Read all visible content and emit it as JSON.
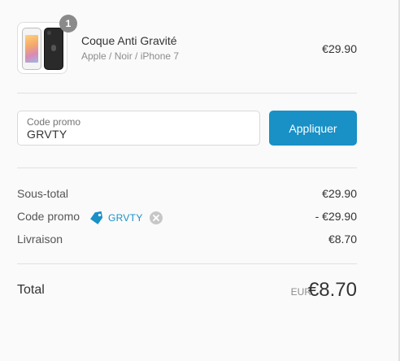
{
  "product": {
    "quantity": "1",
    "name": "Coque Anti Gravité",
    "variant": "Apple / Noir / iPhone 7",
    "price": "€29.90",
    "image_icon": "phone-case-thumbnail"
  },
  "promo": {
    "label": "Code promo",
    "value": "GRVTY",
    "apply_label": "Appliquer"
  },
  "totals": {
    "subtotal_label": "Sous-total",
    "subtotal_value": "€29.90",
    "discount_label": "Code promo",
    "discount_code": "GRVTY",
    "discount_value": "- €29.90",
    "shipping_label": "Livraison",
    "shipping_value": "€8.70"
  },
  "grand_total": {
    "label": "Total",
    "currency": "EUR",
    "amount": "€8.70"
  },
  "colors": {
    "accent": "#1990c6",
    "badge": "#8a8a8a",
    "divider": "#e1e1e1"
  }
}
